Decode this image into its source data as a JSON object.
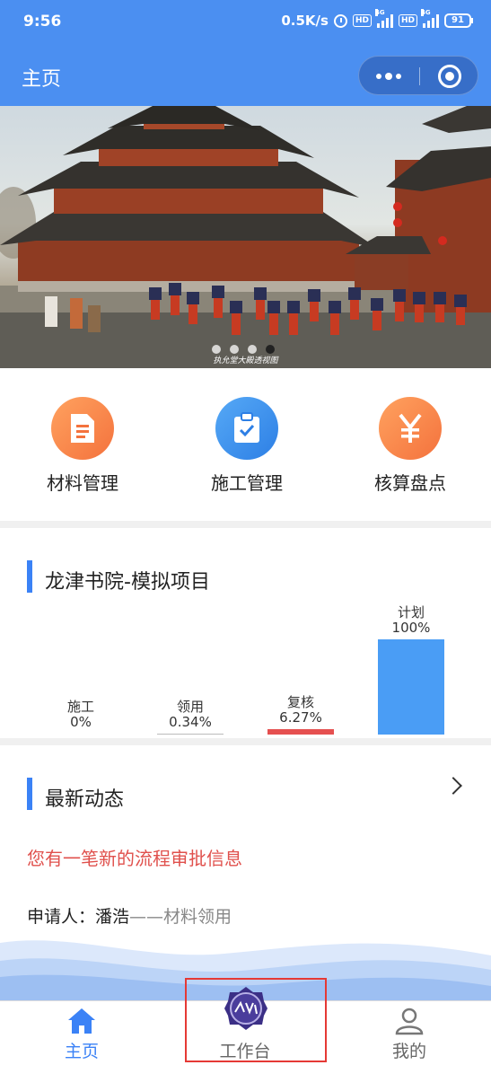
{
  "status_bar": {
    "time": "9:56",
    "speed": "0.5K/s",
    "hd": "HD",
    "network": "4G",
    "battery": "91"
  },
  "nav": {
    "title": "主页",
    "more_icon": "more-dots-icon",
    "close_icon": "target-close-icon"
  },
  "banner": {
    "caption": "执允堂大殿透视图",
    "slide_count": 4,
    "active_slide": 4
  },
  "quick_menu": [
    {
      "label": "材料管理",
      "icon": "document-icon",
      "color": "#f4723d"
    },
    {
      "label": "施工管理",
      "icon": "clipboard-check-icon",
      "color": "#2d7fe5"
    },
    {
      "label": "核算盘点",
      "icon": "yen-icon",
      "color": "#f4723d"
    }
  ],
  "project": {
    "title": "龙津书院-模拟项目"
  },
  "chart_data": {
    "type": "bar",
    "categories": [
      "施工",
      "领用",
      "复核",
      "计划"
    ],
    "values": [
      0,
      0.34,
      6.27,
      100
    ],
    "labels": [
      "0%",
      "0.34%",
      "6.27%",
      "100%"
    ],
    "colors": [
      "#bbbbbb",
      "#bbbbbb",
      "#e55050",
      "#4a9df5"
    ],
    "ylim": [
      0,
      100
    ],
    "grid": false
  },
  "news": {
    "title": "最新动态",
    "alert": "您有一笔新的流程审批信息",
    "applicant_prefix": "申请人：",
    "applicant_name": "潘浩",
    "separator": "——",
    "type": "材料领用"
  },
  "tabbar": [
    {
      "label": "主页",
      "icon": "home-icon",
      "active": true
    },
    {
      "label": "工作台",
      "icon": "workbench-logo-icon",
      "active": false
    },
    {
      "label": "我的",
      "icon": "user-icon",
      "active": false
    }
  ],
  "colors": {
    "primary": "#4b8ff1",
    "alert": "#e0504c",
    "highlight": "#e53935"
  }
}
